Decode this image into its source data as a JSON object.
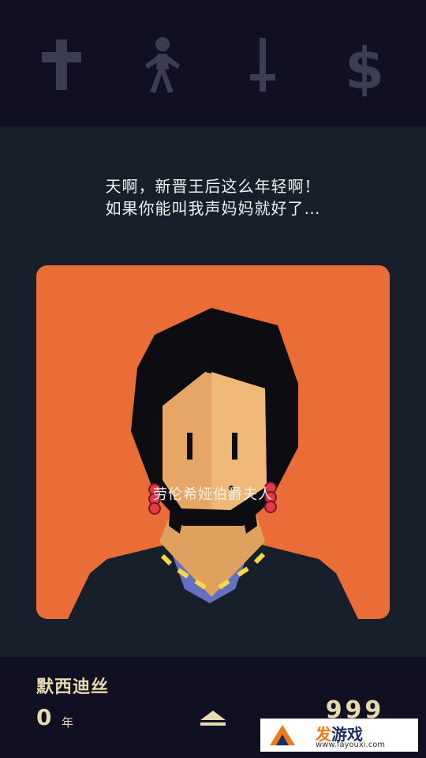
{
  "stats": [
    {
      "name": "church",
      "icon": "cross-icon"
    },
    {
      "name": "people",
      "icon": "person-icon"
    },
    {
      "name": "army",
      "icon": "sword-icon"
    },
    {
      "name": "money",
      "icon": "dollar-icon"
    }
  ],
  "colors": {
    "top_bg": "#111022",
    "main_bg": "#17202a",
    "card_bg": "#ea6c37",
    "stat_icon": "#3d3d51",
    "text_light": "#f1f1f1",
    "text_gold": "#e7d9b0"
  },
  "dialog": {
    "line1": "天啊，新晋王后这么年轻啊！",
    "line2": "如果你能叫我声妈妈就好了…"
  },
  "character": {
    "name": "劳伦希娅伯爵夫人"
  },
  "ruler": {
    "name": "默西迪丝",
    "years": "0",
    "years_unit": "年",
    "reign_count": "999"
  },
  "watermark": {
    "title_accent": "发",
    "title_rest": "游戏",
    "url": "www.fayouxi.com"
  }
}
